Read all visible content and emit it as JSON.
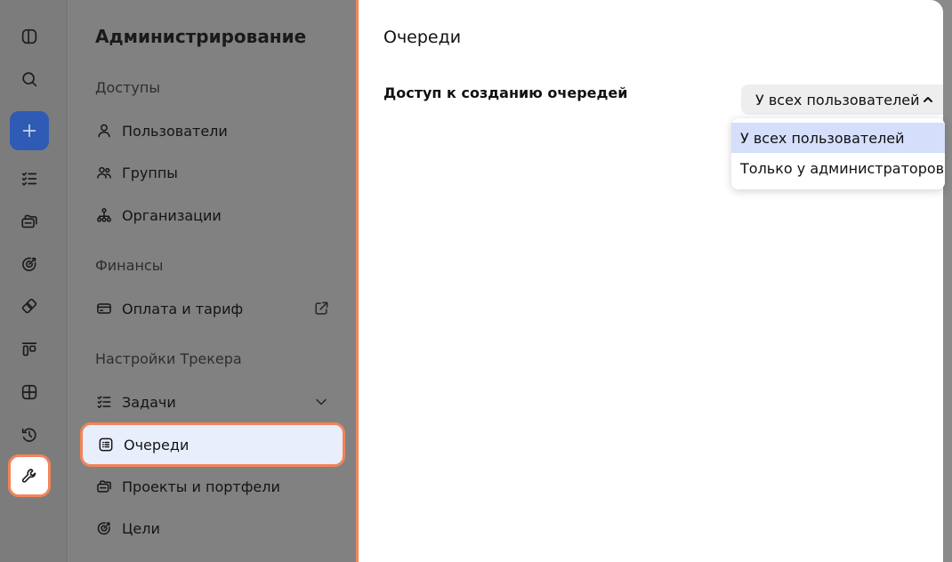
{
  "rail": {
    "items": [
      {
        "icon": "panel-toggle-icon"
      },
      {
        "icon": "search-icon"
      },
      {
        "icon": "plus-icon"
      },
      {
        "icon": "tasks-icon"
      },
      {
        "icon": "projects-icon"
      },
      {
        "icon": "goals-icon"
      },
      {
        "icon": "portfolio-icon"
      },
      {
        "icon": "boards-icon"
      },
      {
        "icon": "dashboards-icon"
      },
      {
        "icon": "history-icon"
      },
      {
        "icon": "wrench-icon"
      }
    ]
  },
  "nav": {
    "title": "Администрирование",
    "sections": {
      "access": "Доступы",
      "finance": "Финансы",
      "tracker": "Настройки Трекера"
    },
    "items": {
      "users": "Пользователи",
      "groups": "Группы",
      "orgs": "Организации",
      "billing": "Оплата и тариф",
      "tasks": "Задачи",
      "queues": "Очереди",
      "projects": "Проекты и портфели",
      "goals": "Цели"
    }
  },
  "main": {
    "title": "Очереди",
    "setting_label": "Доступ к созданию очередей",
    "select_value": "У всех пользователей",
    "options": [
      "У всех пользователей",
      "Только у администраторов"
    ]
  },
  "colors": {
    "accent_outline": "#f2845a",
    "create_button": "#2f5bb4",
    "selected_bg": "#e8eefb",
    "option_highlight": "#d5defb"
  }
}
